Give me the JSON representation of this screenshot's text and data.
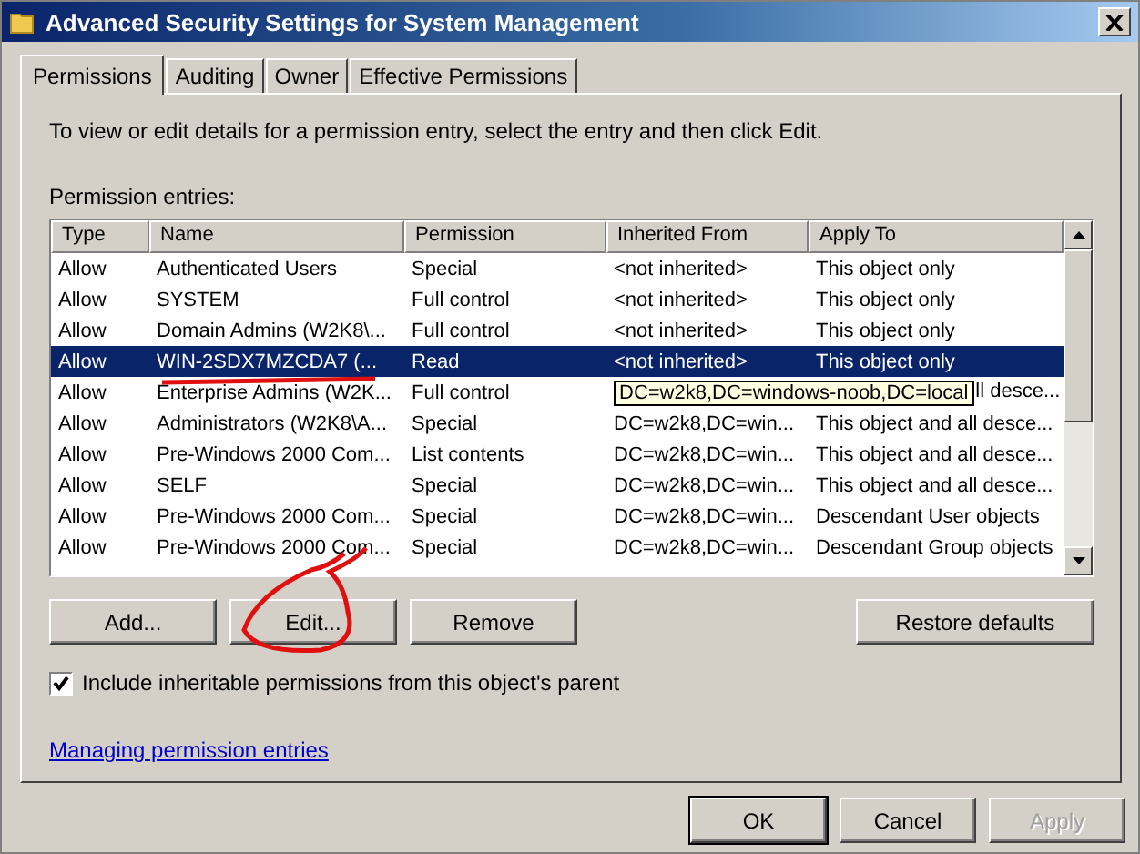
{
  "window": {
    "title": "Advanced Security Settings for System Management"
  },
  "tabs": [
    {
      "label": "Permissions",
      "selected": true
    },
    {
      "label": "Auditing",
      "selected": false
    },
    {
      "label": "Owner",
      "selected": false
    },
    {
      "label": "Effective Permissions",
      "selected": false
    }
  ],
  "instructions": "To view or edit details for a permission entry, select the entry and then click Edit.",
  "list_label": "Permission entries:",
  "table": {
    "columns": [
      "Type",
      "Name",
      "Permission",
      "Inherited From",
      "Apply To"
    ],
    "rows": [
      {
        "type": "Allow",
        "name": "Authenticated Users",
        "permission": "Special",
        "inherited_from": "<not inherited>",
        "apply_to": "This object only",
        "selected": false
      },
      {
        "type": "Allow",
        "name": "SYSTEM",
        "permission": "Full control",
        "inherited_from": "<not inherited>",
        "apply_to": "This object only",
        "selected": false
      },
      {
        "type": "Allow",
        "name": "Domain Admins (W2K8\\...",
        "permission": "Full control",
        "inherited_from": "<not inherited>",
        "apply_to": "This object only",
        "selected": false
      },
      {
        "type": "Allow",
        "name": "WIN-2SDX7MZCDA7 (...",
        "permission": "Read",
        "inherited_from": "<not inherited>",
        "apply_to": "This object only",
        "selected": true
      },
      {
        "type": "Allow",
        "name": "Enterprise Admins (W2K...",
        "permission": "Full control",
        "tooltip": "DC=w2k8,DC=windows-noob,DC=local",
        "apply_to": "ll desce...",
        "selected": false
      },
      {
        "type": "Allow",
        "name": "Administrators (W2K8\\A...",
        "permission": "Special",
        "inherited_from": "DC=w2k8,DC=win...",
        "apply_to": "This object and all desce...",
        "selected": false
      },
      {
        "type": "Allow",
        "name": "Pre-Windows 2000 Com...",
        "permission": "List contents",
        "inherited_from": "DC=w2k8,DC=win...",
        "apply_to": "This object and all desce...",
        "selected": false
      },
      {
        "type": "Allow",
        "name": "SELF",
        "permission": "Special",
        "inherited_from": "DC=w2k8,DC=win...",
        "apply_to": "This object and all desce...",
        "selected": false
      },
      {
        "type": "Allow",
        "name": "Pre-Windows 2000 Com...",
        "permission": "Special",
        "inherited_from": "DC=w2k8,DC=win...",
        "apply_to": "Descendant User objects",
        "selected": false
      },
      {
        "type": "Allow",
        "name": "Pre-Windows 2000 Com...",
        "permission": "Special",
        "inherited_from": "DC=w2k8,DC=win...",
        "apply_to": "Descendant Group objects",
        "selected": false
      }
    ]
  },
  "list_buttons": [
    {
      "label": "Add..."
    },
    {
      "label": "Edit..."
    },
    {
      "label": "Remove"
    }
  ],
  "restore_button": "Restore defaults",
  "inherit_checkbox": {
    "label": "Include inheritable permissions from this object's parent",
    "checked": true
  },
  "help_link": "Managing permission entries",
  "dialog_buttons": [
    {
      "label": "OK",
      "default": true,
      "disabled": false
    },
    {
      "label": "Cancel",
      "default": false,
      "disabled": false
    },
    {
      "label": "Apply",
      "default": false,
      "disabled": true
    }
  ]
}
